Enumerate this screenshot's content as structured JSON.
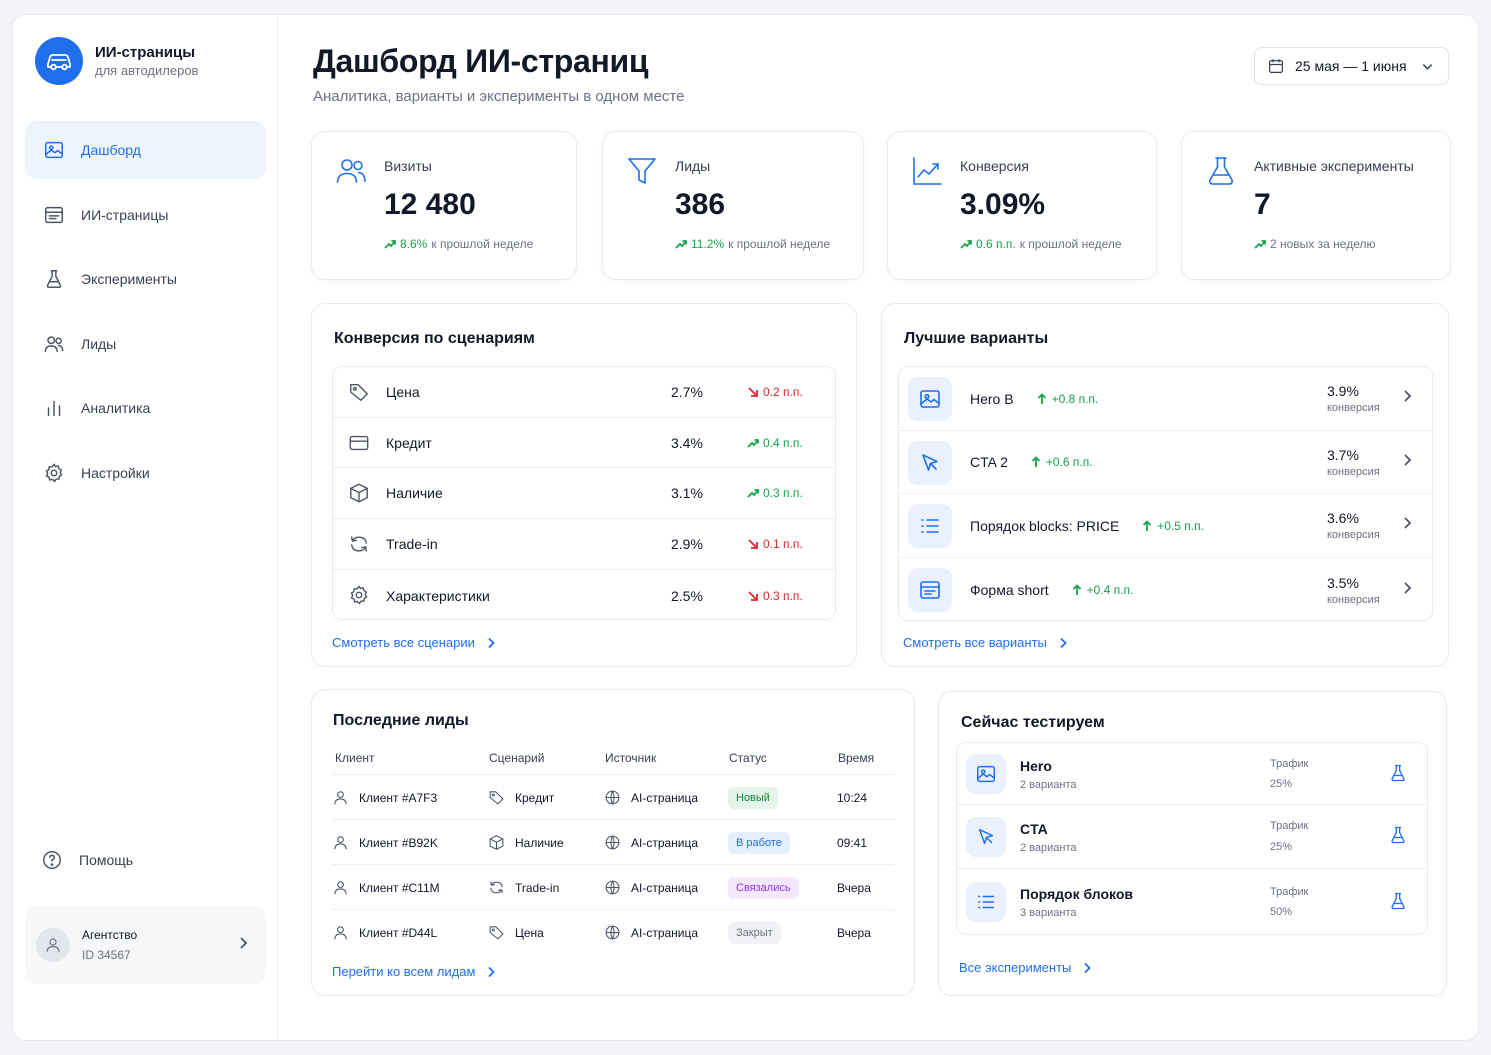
{
  "brand": {
    "title": "ИИ-страницы",
    "subtitle": "для автодилеров"
  },
  "nav": [
    {
      "label": "Дашборд",
      "icon": "dashboard-icon",
      "active": true
    },
    {
      "label": "ИИ-страницы",
      "icon": "pages-icon"
    },
    {
      "label": "Эксперименты",
      "icon": "flask-icon"
    },
    {
      "label": "Лиды",
      "icon": "users-icon"
    },
    {
      "label": "Аналитика",
      "icon": "bar-chart-icon"
    },
    {
      "label": "Настройки",
      "icon": "gear-icon"
    }
  ],
  "help": {
    "label": "Помощь"
  },
  "account": {
    "name": "Агентство",
    "id": "ID 34567"
  },
  "header": {
    "title": "Дашборд ИИ-страниц",
    "subtitle": "Аналитика, варианты и эксперименты в одном месте",
    "date_range": "25 мая — 1 июня"
  },
  "kpis": [
    {
      "label": "Визиты",
      "value": "12 480",
      "delta": "8.6%",
      "delta_text": "к прошлой неделе"
    },
    {
      "label": "Лиды",
      "value": "386",
      "delta": "11.2%",
      "delta_text": "к прошлой неделе"
    },
    {
      "label": "Конверсия",
      "value": "3.09%",
      "delta": "0.6 п.п.",
      "delta_text": "к прошлой неделе"
    },
    {
      "label": "Активные эксперименты",
      "value": "7",
      "delta": "",
      "delta_text": "2 новых за неделю"
    }
  ],
  "scenarios": {
    "title": "Конверсия по сценариям",
    "rows": [
      {
        "name": "Цена",
        "value": "2.7%",
        "delta": "0.2 п.п.",
        "trend": "down"
      },
      {
        "name": "Кредит",
        "value": "3.4%",
        "delta": "0.4 п.п.",
        "trend": "up"
      },
      {
        "name": "Наличие",
        "value": "3.1%",
        "delta": "0.3 п.п.",
        "trend": "up"
      },
      {
        "name": "Trade-in",
        "value": "2.9%",
        "delta": "0.1 п.п.",
        "trend": "down"
      },
      {
        "name": "Характеристики",
        "value": "2.5%",
        "delta": "0.3 п.п.",
        "trend": "down"
      }
    ],
    "link": "Смотреть все сценарии"
  },
  "variants": {
    "title": "Лучшие варианты",
    "rows": [
      {
        "name": "Hero B",
        "delta": "+0.8 п.п.",
        "rate": "3.9%",
        "rate_label": "конверсия"
      },
      {
        "name": "CTA 2",
        "delta": "+0.6 п.п.",
        "rate": "3.7%",
        "rate_label": "конверсия"
      },
      {
        "name": "Порядок blocks: PRICE",
        "delta": "+0.5 п.п.",
        "rate": "3.6%",
        "rate_label": "конверсия"
      },
      {
        "name": "Форма short",
        "delta": "+0.4 п.п.",
        "rate": "3.5%",
        "rate_label": "конверсия"
      }
    ],
    "link": "Смотреть все варианты"
  },
  "leads": {
    "title": "Последние лиды",
    "columns": [
      "Клиент",
      "Сценарий",
      "Источник",
      "Статус",
      "Время"
    ],
    "rows": [
      {
        "client": "Клиент #A7F3",
        "scenario": "Кредит",
        "source": "AI-страница",
        "status": "Новый",
        "time": "10:24"
      },
      {
        "client": "Клиент #B92K",
        "scenario": "Наличие",
        "source": "AI-страница",
        "status": "В работе",
        "time": "09:41"
      },
      {
        "client": "Клиент #C11M",
        "scenario": "Trade-in",
        "source": "AI-страница",
        "status": "Связались",
        "time": "Вчера"
      },
      {
        "client": "Клиент #D44L",
        "scenario": "Цена",
        "source": "AI-страница",
        "status": "Закрыт",
        "time": "Вчера"
      }
    ],
    "link": "Перейти ко всем лидам"
  },
  "testing": {
    "title": "Сейчас тестируем",
    "rows": [
      {
        "name": "Hero",
        "variants": "2 варианта",
        "traffic_label": "Трафик",
        "traffic": "25%"
      },
      {
        "name": "CTA",
        "variants": "2 варианта",
        "traffic_label": "Трафик",
        "traffic": "25%"
      },
      {
        "name": "Порядок блоков",
        "variants": "3 варианта",
        "traffic_label": "Трафик",
        "traffic": "50%"
      }
    ],
    "link": "Все эксперименты"
  },
  "colors": {
    "accent": "#1f6feb",
    "positive": "#16a34a",
    "negative": "#dc2626"
  }
}
